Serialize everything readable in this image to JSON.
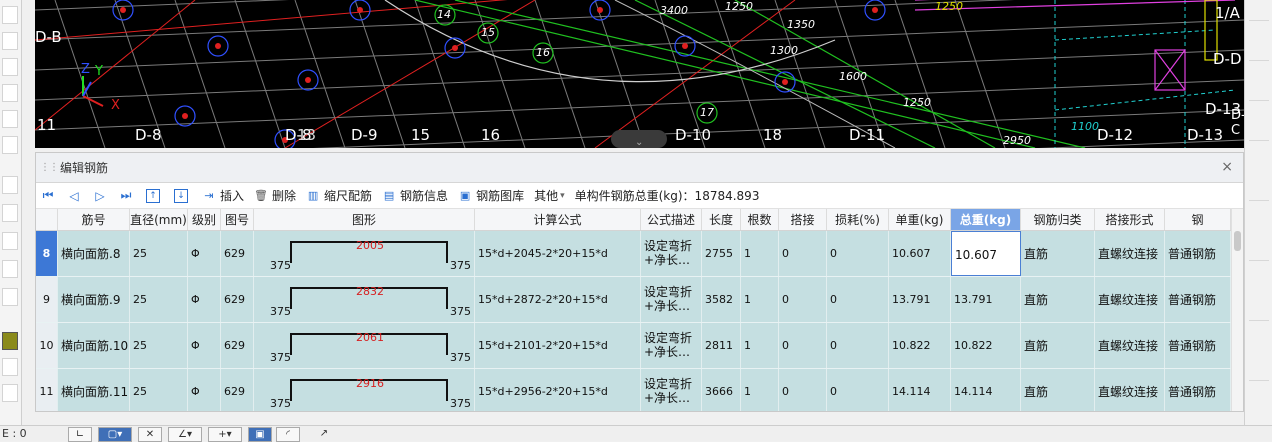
{
  "cad": {
    "labels": [
      "D-B",
      "D-D",
      "11",
      "D-8",
      "D-8",
      "13",
      "D-9",
      "15",
      "16",
      "D-10",
      "18",
      "D-11",
      "D-12",
      "D-13",
      "D-13",
      "1/A",
      "D-C"
    ],
    "circle_labels": [
      "14",
      "15",
      "16",
      "17"
    ],
    "dims": [
      "3400",
      "1250",
      "1350",
      "1300",
      "1600",
      "1250",
      "2950",
      "1100",
      "1250"
    ],
    "axis_x": "X",
    "axis_y": "Y",
    "axis_z": "Z"
  },
  "panel": {
    "title": "编辑钢筋",
    "close_icon": "×"
  },
  "toolbar": {
    "insert": "插入",
    "delete": "删除",
    "scale": "缩尺配筋",
    "info": "钢筋信息",
    "library": "钢筋图库",
    "other": "其他",
    "total": "单构件钢筋总重(kg)：18784.893"
  },
  "columns": [
    "筋号",
    "直径(mm)",
    "级别",
    "图号",
    "图形",
    "计算公式",
    "公式描述",
    "长度",
    "根数",
    "搭接",
    "损耗(%)",
    "单重(kg)",
    "总重(kg)",
    "钢筋归类",
    "搭接形式",
    "钢"
  ],
  "rows": [
    {
      "num": "8",
      "name": "横向面筋.8",
      "dia": "25",
      "grade": "Φ",
      "fig": "629",
      "left": "375",
      "mid": "2005",
      "right": "375",
      "formula": "15*d+2045-2*20+15*d",
      "desc1": "设定弯折",
      "desc2": "+净长…",
      "len": "2755",
      "count": "1",
      "lap": "0",
      "loss": "0",
      "unit": "10.607",
      "total": "10.607",
      "cat": "直筋",
      "form": "直螺纹连接",
      "type": "普通钢筋"
    },
    {
      "num": "9",
      "name": "横向面筋.9",
      "dia": "25",
      "grade": "Φ",
      "fig": "629",
      "left": "375",
      "mid": "2832",
      "right": "375",
      "formula": "15*d+2872-2*20+15*d",
      "desc1": "设定弯折",
      "desc2": "+净长…",
      "len": "3582",
      "count": "1",
      "lap": "0",
      "loss": "0",
      "unit": "13.791",
      "total": "13.791",
      "cat": "直筋",
      "form": "直螺纹连接",
      "type": "普通钢筋"
    },
    {
      "num": "10",
      "name": "横向面筋.10",
      "dia": "25",
      "grade": "Φ",
      "fig": "629",
      "left": "375",
      "mid": "2061",
      "right": "375",
      "formula": "15*d+2101-2*20+15*d",
      "desc1": "设定弯折",
      "desc2": "+净长…",
      "len": "2811",
      "count": "1",
      "lap": "0",
      "loss": "0",
      "unit": "10.822",
      "total": "10.822",
      "cat": "直筋",
      "form": "直螺纹连接",
      "type": "普通钢筋"
    },
    {
      "num": "11",
      "name": "横向面筋.11",
      "dia": "25",
      "grade": "Φ",
      "fig": "629",
      "left": "375",
      "mid": "2916",
      "right": "375",
      "formula": "15*d+2956-2*20+15*d",
      "desc1": "设定弯折",
      "desc2": "+净长…",
      "len": "3666",
      "count": "1",
      "lap": "0",
      "loss": "0",
      "unit": "14.114",
      "total": "14.114",
      "cat": "直筋",
      "form": "直螺纹连接",
      "type": "普通钢筋"
    }
  ],
  "status": {
    "text": "E : 0"
  }
}
